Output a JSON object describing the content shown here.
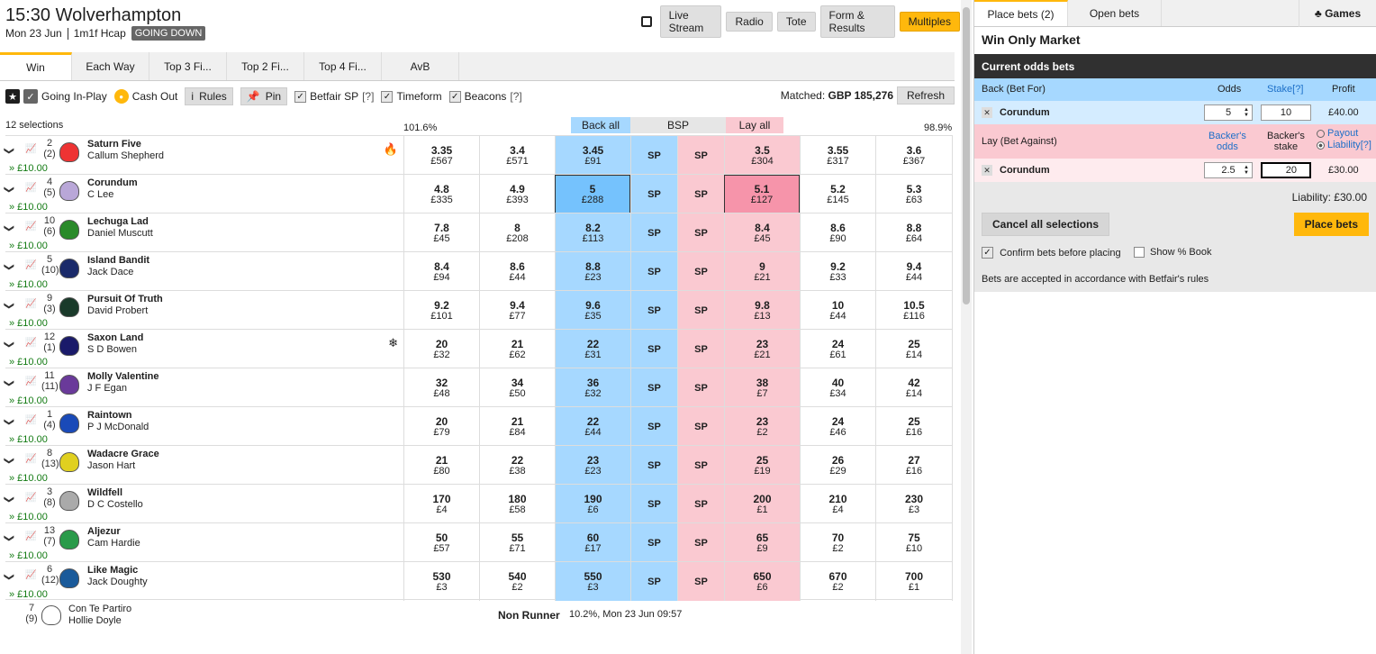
{
  "race": {
    "title": "15:30 Wolverhampton",
    "date": "Mon 23 Jun",
    "type": "1m1f Hcap",
    "status_badge": "GOING DOWN"
  },
  "top_buttons": [
    "Live Stream",
    "Radio",
    "Tote",
    "Form & Results",
    "Multiples"
  ],
  "market_tabs": [
    "Win",
    "Each Way",
    "Top 3 Fi...",
    "Top 2 Fi...",
    "Top 4 Fi...",
    "AvB"
  ],
  "options": {
    "going_in_play": "Going In-Play",
    "cash_out": "Cash Out",
    "rules": "Rules",
    "pin": "Pin",
    "betfair_sp": "Betfair SP",
    "timeform": "Timeform",
    "beacons": "Beacons",
    "help": "[?]",
    "matched_label": "Matched:",
    "matched_value": "GBP 185,276",
    "refresh": "Refresh"
  },
  "header": {
    "selections": "12 selections",
    "back_pct": "101.6%",
    "lay_pct": "98.9%",
    "back_all": "Back all",
    "bsp": "BSP",
    "lay_all": "Lay all"
  },
  "runners": [
    {
      "num": "2",
      "draw": "(2)",
      "name": "Saturn Five",
      "jockey": "Callum Shepherd",
      "stake": "» £10.00",
      "icon": "🔥",
      "silk": "#e33",
      "prices": [
        [
          "3.35",
          "£567"
        ],
        [
          "3.4",
          "£571"
        ],
        [
          "3.45",
          "£91"
        ],
        [
          "SP",
          ""
        ],
        [
          "SP",
          ""
        ],
        [
          "3.5",
          "£304"
        ],
        [
          "3.55",
          "£317"
        ],
        [
          "3.6",
          "£367"
        ]
      ]
    },
    {
      "num": "4",
      "draw": "(5)",
      "name": "Corundum",
      "jockey": "C Lee",
      "stake": "» £10.00",
      "icon": "",
      "silk": "#b9a7d8",
      "prices": [
        [
          "4.8",
          "£335"
        ],
        [
          "4.9",
          "£393"
        ],
        [
          "5",
          "£288"
        ],
        [
          "SP",
          ""
        ],
        [
          "SP",
          ""
        ],
        [
          "5.1",
          "£127"
        ],
        [
          "5.2",
          "£145"
        ],
        [
          "5.3",
          "£63"
        ]
      ]
    },
    {
      "num": "10",
      "draw": "(6)",
      "name": "Lechuga Lad",
      "jockey": "Daniel Muscutt",
      "stake": "» £10.00",
      "icon": "",
      "silk": "#2a8a2a",
      "prices": [
        [
          "7.8",
          "£45"
        ],
        [
          "8",
          "£208"
        ],
        [
          "8.2",
          "£113"
        ],
        [
          "SP",
          ""
        ],
        [
          "SP",
          ""
        ],
        [
          "8.4",
          "£45"
        ],
        [
          "8.6",
          "£90"
        ],
        [
          "8.8",
          "£64"
        ]
      ]
    },
    {
      "num": "5",
      "draw": "(10)",
      "name": "Island Bandit",
      "jockey": "Jack Dace",
      "stake": "» £10.00",
      "icon": "",
      "silk": "#1a2a6a",
      "prices": [
        [
          "8.4",
          "£94"
        ],
        [
          "8.6",
          "£44"
        ],
        [
          "8.8",
          "£23"
        ],
        [
          "SP",
          ""
        ],
        [
          "SP",
          ""
        ],
        [
          "9",
          "£21"
        ],
        [
          "9.2",
          "£33"
        ],
        [
          "9.4",
          "£44"
        ]
      ]
    },
    {
      "num": "9",
      "draw": "(3)",
      "name": "Pursuit Of Truth",
      "jockey": "David Probert",
      "stake": "» £10.00",
      "icon": "",
      "silk": "#1a3a2a",
      "prices": [
        [
          "9.2",
          "£101"
        ],
        [
          "9.4",
          "£77"
        ],
        [
          "9.6",
          "£35"
        ],
        [
          "SP",
          ""
        ],
        [
          "SP",
          ""
        ],
        [
          "9.8",
          "£13"
        ],
        [
          "10",
          "£44"
        ],
        [
          "10.5",
          "£116"
        ]
      ]
    },
    {
      "num": "12",
      "draw": "(1)",
      "name": "Saxon Land",
      "jockey": "S D Bowen",
      "stake": "» £10.00",
      "icon": "❄",
      "silk": "#1a1a6a",
      "prices": [
        [
          "20",
          "£32"
        ],
        [
          "21",
          "£62"
        ],
        [
          "22",
          "£31"
        ],
        [
          "SP",
          ""
        ],
        [
          "SP",
          ""
        ],
        [
          "23",
          "£21"
        ],
        [
          "24",
          "£61"
        ],
        [
          "25",
          "£14"
        ]
      ]
    },
    {
      "num": "11",
      "draw": "(11)",
      "name": "Molly Valentine",
      "jockey": "J F Egan",
      "stake": "» £10.00",
      "icon": "",
      "silk": "#6a3a9a",
      "prices": [
        [
          "32",
          "£48"
        ],
        [
          "34",
          "£50"
        ],
        [
          "36",
          "£32"
        ],
        [
          "SP",
          ""
        ],
        [
          "SP",
          ""
        ],
        [
          "38",
          "£7"
        ],
        [
          "40",
          "£34"
        ],
        [
          "42",
          "£14"
        ]
      ]
    },
    {
      "num": "1",
      "draw": "(4)",
      "name": "Raintown",
      "jockey": "P J McDonald",
      "stake": "» £10.00",
      "icon": "",
      "silk": "#1a4ab8",
      "prices": [
        [
          "20",
          "£79"
        ],
        [
          "21",
          "£84"
        ],
        [
          "22",
          "£44"
        ],
        [
          "SP",
          ""
        ],
        [
          "SP",
          ""
        ],
        [
          "23",
          "£2"
        ],
        [
          "24",
          "£46"
        ],
        [
          "25",
          "£16"
        ]
      ]
    },
    {
      "num": "8",
      "draw": "(13)",
      "name": "Wadacre Grace",
      "jockey": "Jason Hart",
      "stake": "» £10.00",
      "icon": "",
      "silk": "#e0d020",
      "prices": [
        [
          "21",
          "£80"
        ],
        [
          "22",
          "£38"
        ],
        [
          "23",
          "£23"
        ],
        [
          "SP",
          ""
        ],
        [
          "SP",
          ""
        ],
        [
          "25",
          "£19"
        ],
        [
          "26",
          "£29"
        ],
        [
          "27",
          "£16"
        ]
      ]
    },
    {
      "num": "3",
      "draw": "(8)",
      "name": "Wildfell",
      "jockey": "D C Costello",
      "stake": "» £10.00",
      "icon": "",
      "silk": "#aaaaaa",
      "prices": [
        [
          "170",
          "£4"
        ],
        [
          "180",
          "£58"
        ],
        [
          "190",
          "£6"
        ],
        [
          "SP",
          ""
        ],
        [
          "SP",
          ""
        ],
        [
          "200",
          "£1"
        ],
        [
          "210",
          "£4"
        ],
        [
          "230",
          "£3"
        ]
      ]
    },
    {
      "num": "13",
      "draw": "(7)",
      "name": "Aljezur",
      "jockey": "Cam Hardie",
      "stake": "» £10.00",
      "icon": "",
      "silk": "#2a9a4a",
      "prices": [
        [
          "50",
          "£57"
        ],
        [
          "55",
          "£71"
        ],
        [
          "60",
          "£17"
        ],
        [
          "SP",
          ""
        ],
        [
          "SP",
          ""
        ],
        [
          "65",
          "£9"
        ],
        [
          "70",
          "£2"
        ],
        [
          "75",
          "£10"
        ]
      ]
    },
    {
      "num": "6",
      "draw": "(12)",
      "name": "Like Magic",
      "jockey": "Jack Doughty",
      "stake": "» £10.00",
      "icon": "",
      "silk": "#1a5a9a",
      "prices": [
        [
          "530",
          "£3"
        ],
        [
          "540",
          "£2"
        ],
        [
          "550",
          "£3"
        ],
        [
          "SP",
          ""
        ],
        [
          "SP",
          ""
        ],
        [
          "650",
          "£6"
        ],
        [
          "670",
          "£2"
        ],
        [
          "700",
          "£1"
        ]
      ]
    }
  ],
  "non_runner": {
    "num": "7",
    "draw": "(9)",
    "name": "Con Te Partiro",
    "jockey": "Hollie Doyle",
    "label": "Non Runner",
    "info": "10.2%, Mon 23 Jun 09:57"
  },
  "betslip": {
    "tab_place": "Place bets (2)",
    "tab_open": "Open bets",
    "tab_games": "Games",
    "market": "Win Only Market",
    "current": "Current odds bets",
    "back_header": "Back (Bet For)",
    "odds_label": "Odds",
    "stake_label": "Stake",
    "stake_help": "[?]",
    "profit_label": "Profit",
    "back_name": "Corundum",
    "back_odds": "5",
    "back_stake": "10",
    "back_profit": "£40.00",
    "lay_header": "Lay (Bet Against)",
    "backers_odds_1": "Backer's",
    "backers_odds_2": "odds",
    "backers_stake_1": "Backer's",
    "backers_stake_2": "stake",
    "payout": "Payout",
    "liability_opt": "Liability",
    "lay_help": "[?]",
    "lay_name": "Corundum",
    "lay_odds": "2.5",
    "lay_stake": "20",
    "lay_liab": "£30.00",
    "liability_total": "Liability: £30.00",
    "cancel": "Cancel all selections",
    "place": "Place bets",
    "confirm": "Confirm bets before placing",
    "show_book": "Show % Book",
    "accepted": "Bets are accepted in accordance with Betfair's rules"
  },
  "colors": {
    "back": "#a6d8ff",
    "lay": "#fac9d1",
    "accent": "#ffb80c"
  }
}
